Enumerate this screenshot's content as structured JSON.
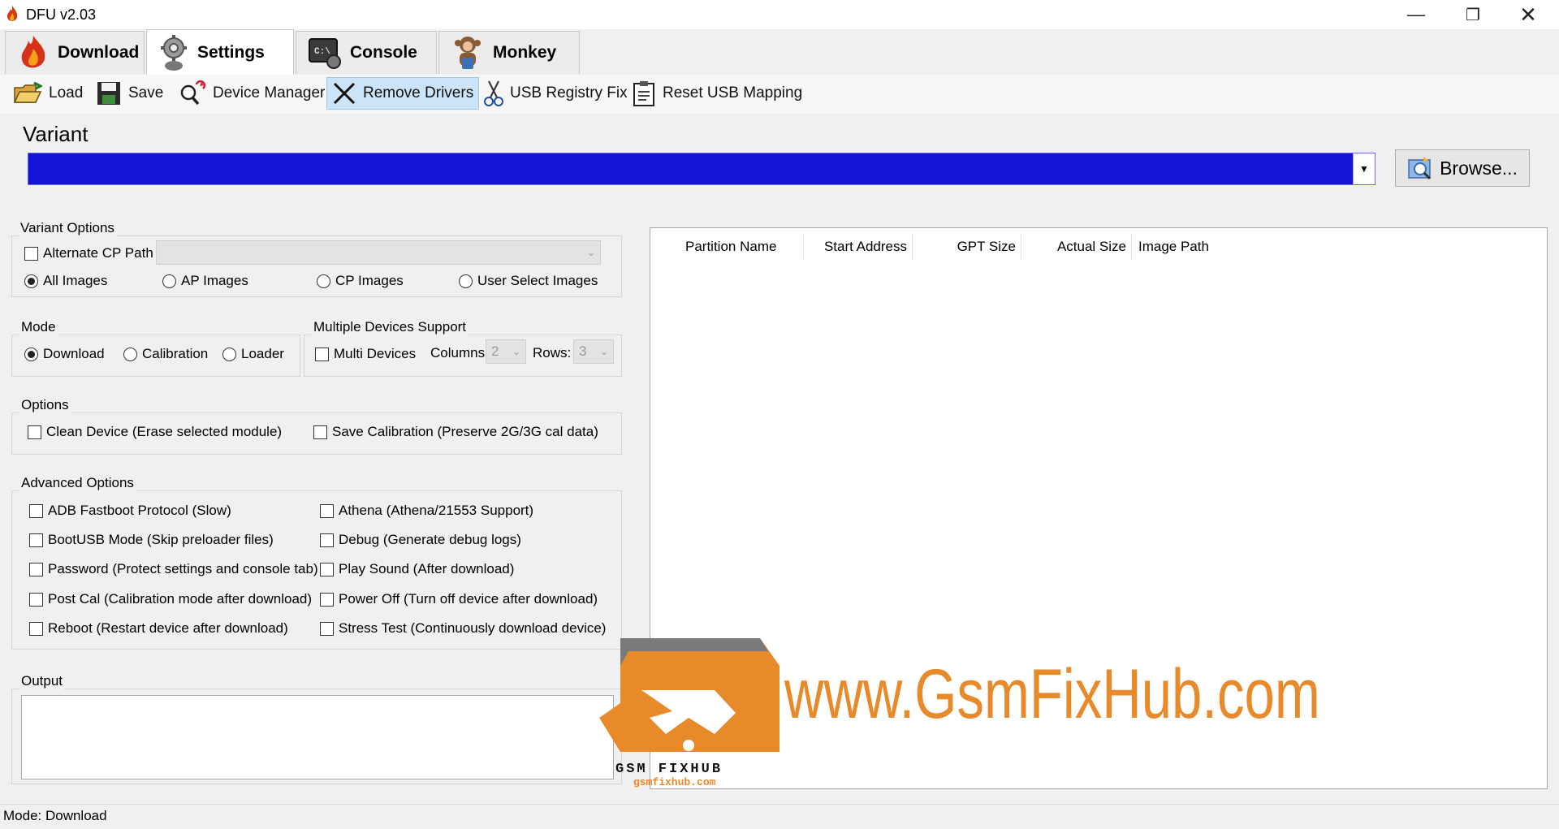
{
  "window": {
    "title": "DFU v2.03",
    "controls": [
      "minimize",
      "restore",
      "close"
    ]
  },
  "tabs": [
    {
      "label": "Download",
      "icon": "flame-icon",
      "active": false
    },
    {
      "label": "Settings",
      "icon": "gear-icon",
      "active": true
    },
    {
      "label": "Console",
      "icon": "console-icon",
      "active": false
    },
    {
      "label": "Monkey",
      "icon": "monkey-icon",
      "active": false
    }
  ],
  "toolbar": {
    "load": "Load",
    "save": "Save",
    "device_manager": "Device Manager",
    "remove_drivers": "Remove Drivers",
    "usb_registry_fix": "USB Registry Fix",
    "reset_usb_mapping": "Reset USB Mapping"
  },
  "variant": {
    "label": "Variant",
    "value": "",
    "browse": "Browse..."
  },
  "variant_options": {
    "label": "Variant Options",
    "alternate_cp_path": "Alternate CP Path",
    "alternate_cp_path_checked": false,
    "radios": [
      {
        "label": "All Images",
        "checked": true
      },
      {
        "label": "AP Images",
        "checked": false
      },
      {
        "label": "CP Images",
        "checked": false
      },
      {
        "label": "User Select Images",
        "checked": false
      }
    ]
  },
  "mode": {
    "label": "Mode",
    "radios": [
      {
        "label": "Download",
        "checked": true
      },
      {
        "label": "Calibration",
        "checked": false
      },
      {
        "label": "Loader",
        "checked": false
      }
    ]
  },
  "multi": {
    "label": "Multiple Devices Support",
    "multi_devices": "Multi Devices",
    "columns_label": "Columns:",
    "columns_value": "2",
    "rows_label": "Rows:",
    "rows_value": "3"
  },
  "options": {
    "label": "Options",
    "clean_device": "Clean Device (Erase selected module)",
    "save_calibration": "Save Calibration (Preserve 2G/3G cal data)"
  },
  "advanced": {
    "label": "Advanced Options",
    "left": [
      "ADB Fastboot Protocol (Slow)",
      "BootUSB Mode (Skip preloader files)",
      "Password (Protect settings and console tab)",
      "Post Cal (Calibration mode after download)",
      "Reboot (Restart device after download)"
    ],
    "right": [
      "Athena (Athena/21553 Support)",
      "Debug (Generate debug logs)",
      "Play Sound (After download)",
      "Power Off (Turn off device after download)",
      "Stress Test (Continuously download device)"
    ]
  },
  "output": {
    "label": "Output",
    "text": ""
  },
  "partition_table": {
    "columns": [
      "Partition Name",
      "Start Address",
      "GPT Size",
      "Actual Size",
      "Image Path"
    ],
    "rows": []
  },
  "watermark": {
    "url": "www.GsmFixHub.com",
    "brand": "GSM FIXHUB",
    "small_url": "gsmfixhub.com",
    "color": "#e8892a"
  },
  "status": {
    "text": "Mode: Download"
  },
  "colors": {
    "variant_selected": "#1414d6",
    "accent_highlight": "#cce4f7"
  }
}
